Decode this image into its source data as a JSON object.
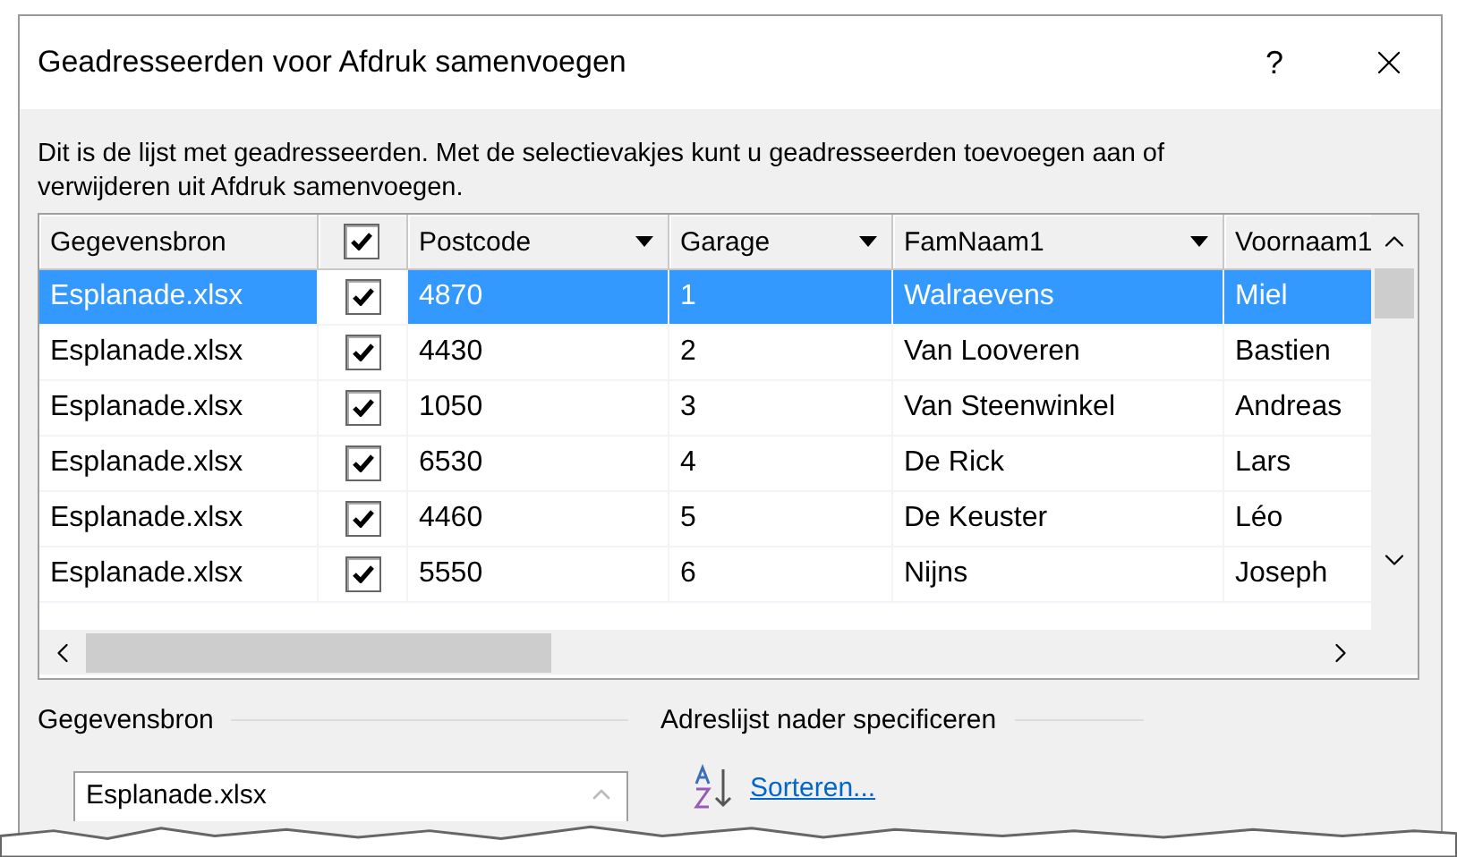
{
  "window": {
    "title": "Geadresseerden voor Afdruk samenvoegen",
    "help": "?"
  },
  "description": "Dit is de lijst met geadresseerden. Met de selectievakjes kunt u geadresseerden toevoegen aan of verwijderen uit Afdruk samenvoegen.",
  "table": {
    "header_checked": true,
    "columns": [
      {
        "label": "Gegevensbron",
        "dropdown": false
      },
      {
        "label": "Postcode",
        "dropdown": true
      },
      {
        "label": "Garage",
        "dropdown": true
      },
      {
        "label": "FamNaam1",
        "dropdown": true
      },
      {
        "label": "Voornaam1",
        "dropdown": false
      }
    ],
    "rows": [
      {
        "selected": true,
        "checked": true,
        "cells": [
          "Esplanade.xlsx",
          "4870",
          "1",
          "Walraevens",
          "Miel"
        ]
      },
      {
        "selected": false,
        "checked": true,
        "cells": [
          "Esplanade.xlsx",
          "4430",
          "2",
          "Van Looveren",
          "Bastien"
        ]
      },
      {
        "selected": false,
        "checked": true,
        "cells": [
          "Esplanade.xlsx",
          "1050",
          "3",
          "Van Steenwinkel",
          "Andreas"
        ]
      },
      {
        "selected": false,
        "checked": true,
        "cells": [
          "Esplanade.xlsx",
          "6530",
          "4",
          "De Rick",
          "Lars"
        ]
      },
      {
        "selected": false,
        "checked": true,
        "cells": [
          "Esplanade.xlsx",
          "4460",
          "5",
          "De Keuster",
          "Léo"
        ]
      },
      {
        "selected": false,
        "checked": true,
        "cells": [
          "Esplanade.xlsx",
          "5550",
          "6",
          "Nijns",
          "Joseph"
        ]
      }
    ]
  },
  "data_source": {
    "label": "Gegevensbron",
    "items": [
      "Esplanade.xlsx"
    ]
  },
  "refine": {
    "label": "Adreslijst nader specificeren",
    "links": [
      "Sorteren..."
    ]
  }
}
